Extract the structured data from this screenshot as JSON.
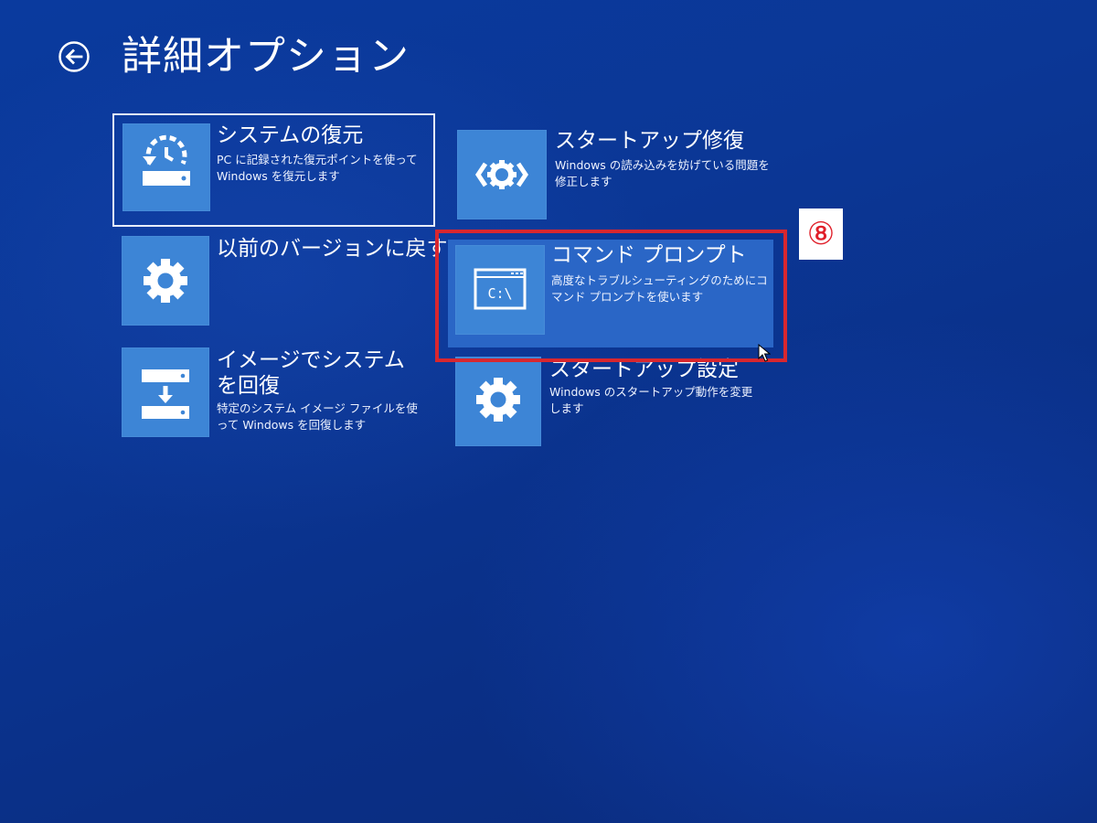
{
  "header": {
    "title": "詳細オプション",
    "back_icon": "back-arrow-icon"
  },
  "tiles": [
    {
      "title": "システムの復元",
      "description": "PC に記録された復元ポイントを使って Windows を復元します",
      "icon": "system-restore-icon",
      "selected": true
    },
    {
      "title": "スタートアップ修復",
      "description": "Windows の読み込みを妨げている問題を修正します",
      "icon": "startup-repair-icon"
    },
    {
      "title": "以前のバージョンに戻す",
      "description": "",
      "icon": "gear-icon"
    },
    {
      "title": "コマンド プロンプト",
      "description": "高度なトラブルシューティングのためにコマンド プロンプトを使います",
      "icon": "command-prompt-icon",
      "icon_text": "C:\\",
      "hovered": true
    },
    {
      "title": "イメージでシステムを回復",
      "description": "特定のシステム イメージ ファイルを使って Windows を回復します",
      "icon": "system-image-recovery-icon"
    },
    {
      "title": "スタートアップ設定",
      "description": "Windows のスタートアップ動作を変更します",
      "icon": "gear-icon"
    }
  ],
  "annotation": {
    "marker": "⑧",
    "color": "#d8272f"
  },
  "colors": {
    "background": "#0b3796",
    "tile_icon": "#3d85d6",
    "hover_tile": "#2a66c6"
  }
}
